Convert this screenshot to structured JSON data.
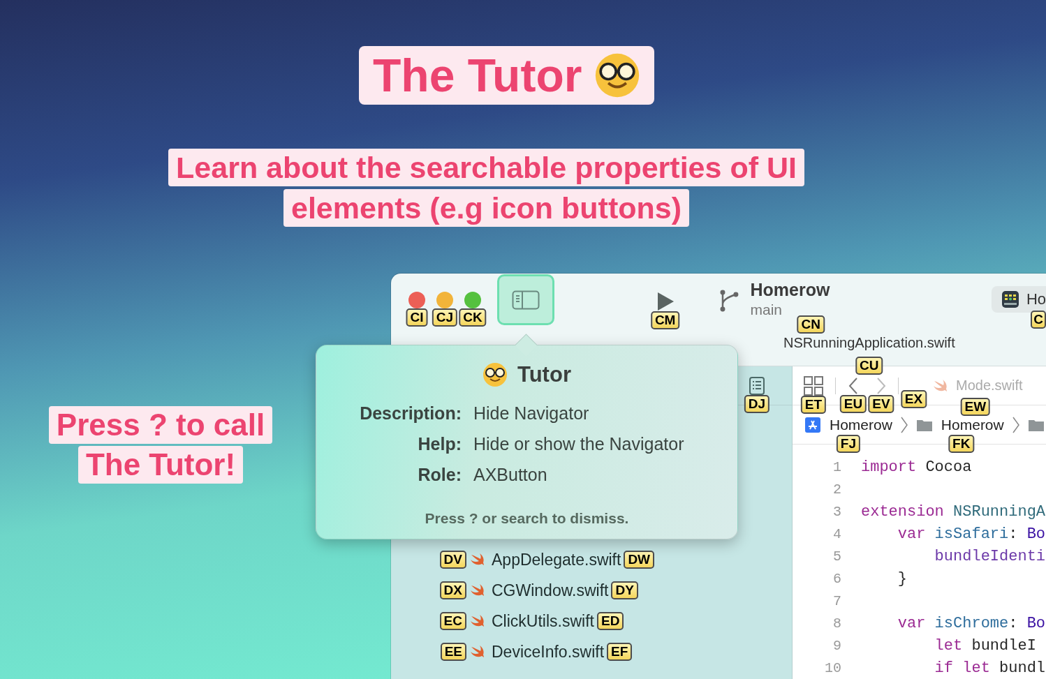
{
  "headline": {
    "title": "The Tutor",
    "subtitle_lines": [
      "Learn about the searchable properties of UI",
      "elements (e.g icon buttons)"
    ]
  },
  "callout_lines": [
    "Press ? to call",
    "The Tutor!"
  ],
  "window": {
    "traffic_lights": [
      {
        "kind": "close",
        "hint": "CI"
      },
      {
        "kind": "minimize",
        "hint": "CJ"
      },
      {
        "kind": "zoom",
        "hint": "CK"
      }
    ],
    "sidebar_toggle": {
      "highlighted": true
    },
    "run_hint": "CM",
    "project": {
      "name": "Homerow",
      "branch": "main",
      "hint": "CN"
    },
    "scheme": {
      "text": "Ho",
      "hint": "C"
    },
    "active_file": {
      "text": "NSRunningApplication.swift",
      "hint": "CU"
    },
    "navigator": {
      "hint": "DJ",
      "files": [
        {
          "name": "AppDelegate.swift",
          "icon_hint": "DV",
          "name_hint": "DW"
        },
        {
          "name": "CGWindow.swift",
          "icon_hint": "DX",
          "name_hint": "DY"
        },
        {
          "name": "ClickUtils.swift",
          "icon_hint": "EC",
          "name_hint": "ED"
        },
        {
          "name": "DeviceInfo.swift",
          "icon_hint": "EE",
          "name_hint": "EF"
        }
      ]
    },
    "editor_bar": {
      "grid_hint": "ET",
      "back_hint": "EU",
      "forward_hint": "EV",
      "separator_hint": "EX",
      "tab": {
        "text": "Mode.swift",
        "hint": "EW"
      }
    },
    "breadcrumbs": [
      {
        "kind": "project",
        "text": "Homerow",
        "hint": "FJ"
      },
      {
        "kind": "folder",
        "text": "Homerow",
        "hint": "FK"
      },
      {
        "kind": "folder"
      }
    ],
    "code_lines": [
      {
        "number": "1",
        "tokens": [
          {
            "kind": "keyword",
            "text": "import"
          },
          {
            "kind": "plain",
            "text": " Cocoa"
          }
        ]
      },
      {
        "number": "2"
      },
      {
        "number": "3",
        "tokens": [
          {
            "kind": "keyword",
            "text": "extension"
          },
          {
            "kind": "type",
            "text": " NSRunningA"
          }
        ]
      },
      {
        "number": "4",
        "tokens": [
          {
            "kind": "keyword",
            "text": "    var"
          },
          {
            "kind": "property",
            "text": " isSafari"
          },
          {
            "kind": "plain",
            "text": ": "
          },
          {
            "kind": "builtin",
            "text": "Bo"
          }
        ]
      },
      {
        "number": "5",
        "tokens": [
          {
            "kind": "member",
            "text": "        bundleIdenti"
          }
        ]
      },
      {
        "number": "6",
        "tokens": [
          {
            "kind": "plain",
            "text": "    }"
          }
        ]
      },
      {
        "number": "7"
      },
      {
        "number": "8",
        "tokens": [
          {
            "kind": "keyword",
            "text": "    var"
          },
          {
            "kind": "property",
            "text": " isChrome"
          },
          {
            "kind": "plain",
            "text": ": "
          },
          {
            "kind": "builtin",
            "text": "Bo"
          }
        ]
      },
      {
        "number": "9",
        "tokens": [
          {
            "kind": "keyword",
            "text": "        let"
          },
          {
            "kind": "plain",
            "text": " bundleI"
          }
        ]
      },
      {
        "number": "10",
        "tokens": [
          {
            "kind": "keyword",
            "text": "        if let"
          },
          {
            "kind": "plain",
            "text": " bundl"
          }
        ]
      }
    ]
  },
  "popover": {
    "title": "Tutor",
    "rows": [
      {
        "label": "Description:",
        "value": "Hide Navigator"
      },
      {
        "label": "Help:",
        "value": "Hide or show the Navigator"
      },
      {
        "label": "Role:",
        "value": "AXButton"
      }
    ],
    "footer": "Press ? or search to dismiss."
  }
}
